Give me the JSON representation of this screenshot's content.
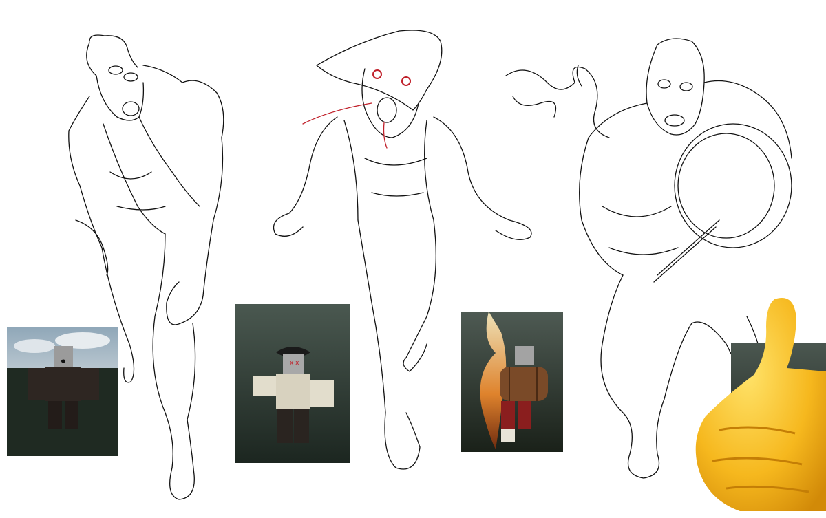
{
  "figures": [
    {
      "id": "zombie-suit",
      "description_icon": "hunched-zombie-sketch"
    },
    {
      "id": "zombie-hat",
      "description_icon": "screaming-zombie-hat-sketch"
    },
    {
      "id": "zombie-barrel",
      "description_icon": "zombie-carrying-barrel-sketch"
    }
  ],
  "thumbnails": [
    {
      "id": "render-suit",
      "icon": "roblox-suit-zombie-render"
    },
    {
      "id": "render-hat",
      "icon": "roblox-hat-zombie-render"
    },
    {
      "id": "render-barrel",
      "icon": "roblox-barrel-zombie-render"
    },
    {
      "id": "render-partial",
      "icon": "partial-render"
    }
  ],
  "emoji": {
    "icon": "thumbs-up-emoji"
  },
  "colors": {
    "sky": "#8fa7b8",
    "ground": "#1f2a22",
    "eyes_red": "#c0202a",
    "thumb_yellow": "#f6b81e"
  }
}
